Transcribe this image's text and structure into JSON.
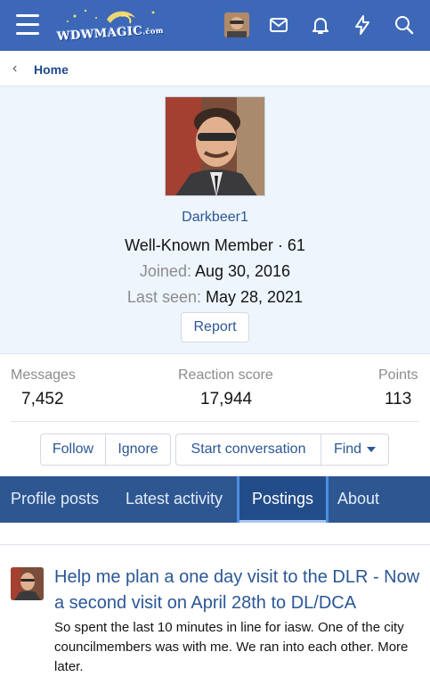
{
  "header": {
    "logo_text": "WDWMAGIC",
    "logo_suffix": ".com",
    "icons": [
      "menu-icon",
      "avatar",
      "mail-icon",
      "bell-icon",
      "lightning-icon",
      "search-icon"
    ],
    "bg_color": "#3d68b8"
  },
  "breadcrumb": {
    "chevron": "‹",
    "home_label": "Home"
  },
  "profile": {
    "username": "Darkbeer1",
    "title": "Well-Known Member · 61",
    "joined_label": "Joined:",
    "joined_value": "Aug 30, 2016",
    "last_seen_label": "Last seen:",
    "last_seen_value": "May 28, 2021",
    "report_label": "Report"
  },
  "stats": {
    "messages_label": "Messages",
    "messages_value": "7,452",
    "reaction_label": "Reaction score",
    "reaction_value": "17,944",
    "points_label": "Points",
    "points_value": "113"
  },
  "actions": {
    "follow": "Follow",
    "ignore": "Ignore",
    "start_conversation": "Start conversation",
    "find": "Find"
  },
  "tabs": {
    "profile_posts": "Profile posts",
    "latest_activity": "Latest activity",
    "postings": "Postings",
    "about": "About",
    "active": "Postings"
  },
  "post": {
    "title": "Help me plan a one day visit to the DLR - Now a second visit on April 28th to DL/DCA",
    "snippet": "So spent the last 10 minutes in line for iasw. One of the city councilmembers was with me. We ran into each other. More later."
  },
  "colors": {
    "link": "#2b5796",
    "tab_bar": "#2e5791",
    "profile_bg": "#eef5fd"
  }
}
